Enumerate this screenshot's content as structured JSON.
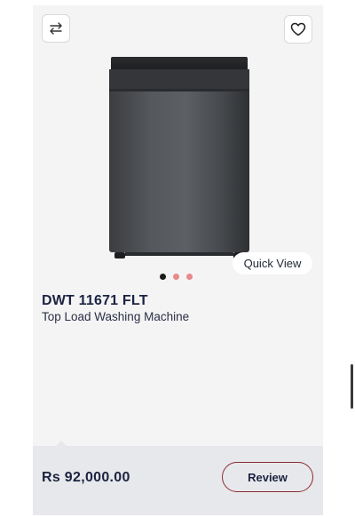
{
  "product": {
    "model": "DWT 11671 FLT",
    "subtitle": "Top Load Washing Machine",
    "price": "Rs 92,000.00"
  },
  "actions": {
    "quick_view_label": "Quick View",
    "review_label": "Review"
  },
  "icons": {
    "compare": "compare-arrows-icon",
    "wishlist": "heart-icon"
  },
  "carousel": {
    "count": 3,
    "active_index": 0
  },
  "colors": {
    "card_bg": "#f4f4f5",
    "footer_bg": "#e7e8eb",
    "accent": "#8a2c34",
    "text_dark": "#1b2340",
    "dot_active": "#1a1a1a",
    "dot_inactive": "#e8898a"
  }
}
